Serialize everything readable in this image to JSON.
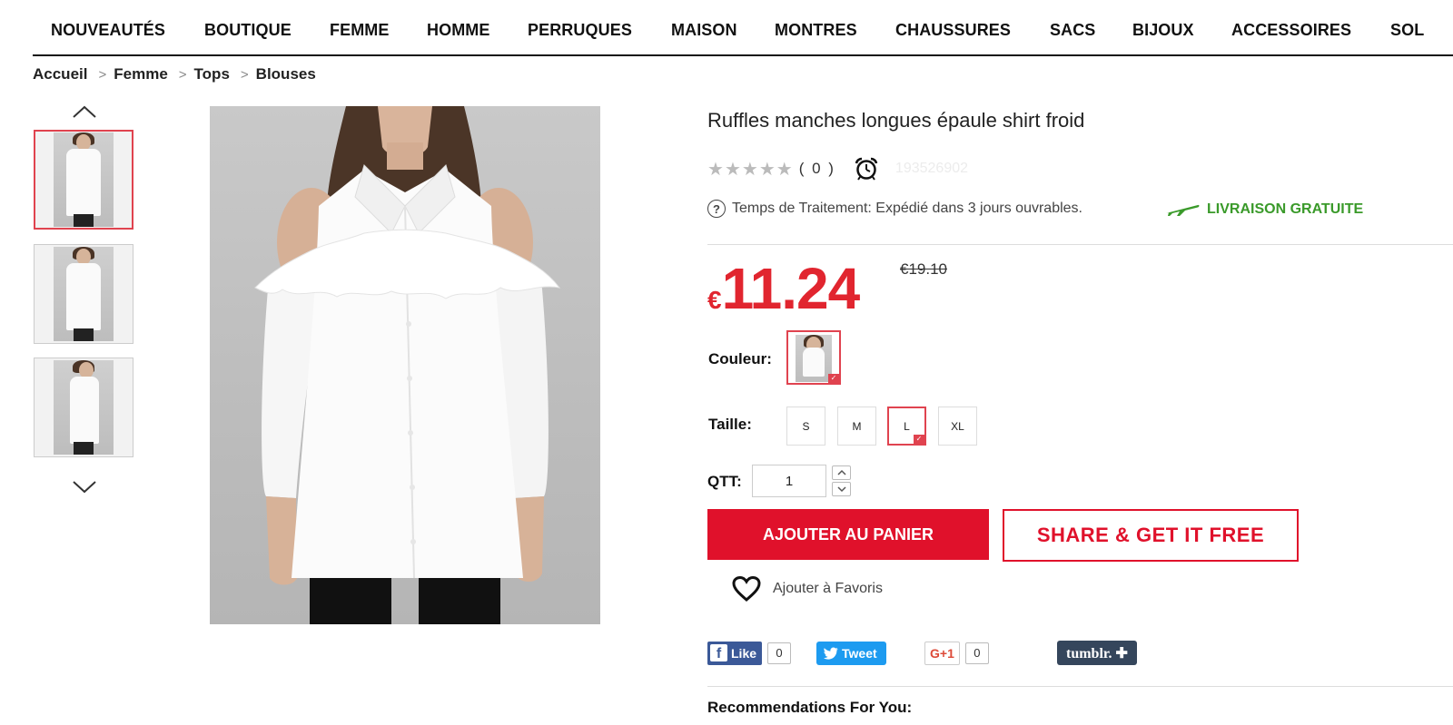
{
  "nav": {
    "items": [
      "NOUVEAUTÉS",
      "BOUTIQUE",
      "FEMME",
      "HOMME",
      "PERRUQUES",
      "MAISON",
      "MONTRES",
      "CHAUSSURES",
      "SACS",
      "BIJOUX",
      "ACCESSOIRES",
      "SOL"
    ]
  },
  "breadcrumb": {
    "items": [
      "Accueil",
      "Femme",
      "Tops",
      "Blouses"
    ],
    "separator": ">"
  },
  "gallery": {
    "up_icon": "chevron-up-icon",
    "down_icon": "chevron-down-icon",
    "active_index": 0
  },
  "product": {
    "title": "Ruffles manches longues épaule shirt froid",
    "rating_count": "( 0 )",
    "sku": "193526902",
    "processing_time": "Temps de Traitement: Expédié dans 3 jours ouvrables.",
    "free_shipping": "LIVRAISON GRATUITE",
    "price_currency": "€",
    "price": "11.24",
    "old_price": "€19.10",
    "color_label": "Couleur:",
    "size_label": "Taille:",
    "sizes": [
      "S",
      "M",
      "L",
      "XL"
    ],
    "selected_size": "L",
    "qty_label": "QTT:",
    "qty_value": "1",
    "add_to_cart": "AJOUTER AU PANIER",
    "share_free": "SHARE & GET IT FREE",
    "add_favorites": "Ajouter à Favoris",
    "accent_color": "#e0112b",
    "ship_color": "#3a9a2a"
  },
  "social": {
    "fb_label": "Like",
    "fb_count": "0",
    "tweet_label": "Tweet",
    "gplus_label": "G+1",
    "gplus_count": "0",
    "tumblr_label": "tumblr. ✚"
  },
  "recommendations": {
    "title": "Recommendations For You:"
  }
}
